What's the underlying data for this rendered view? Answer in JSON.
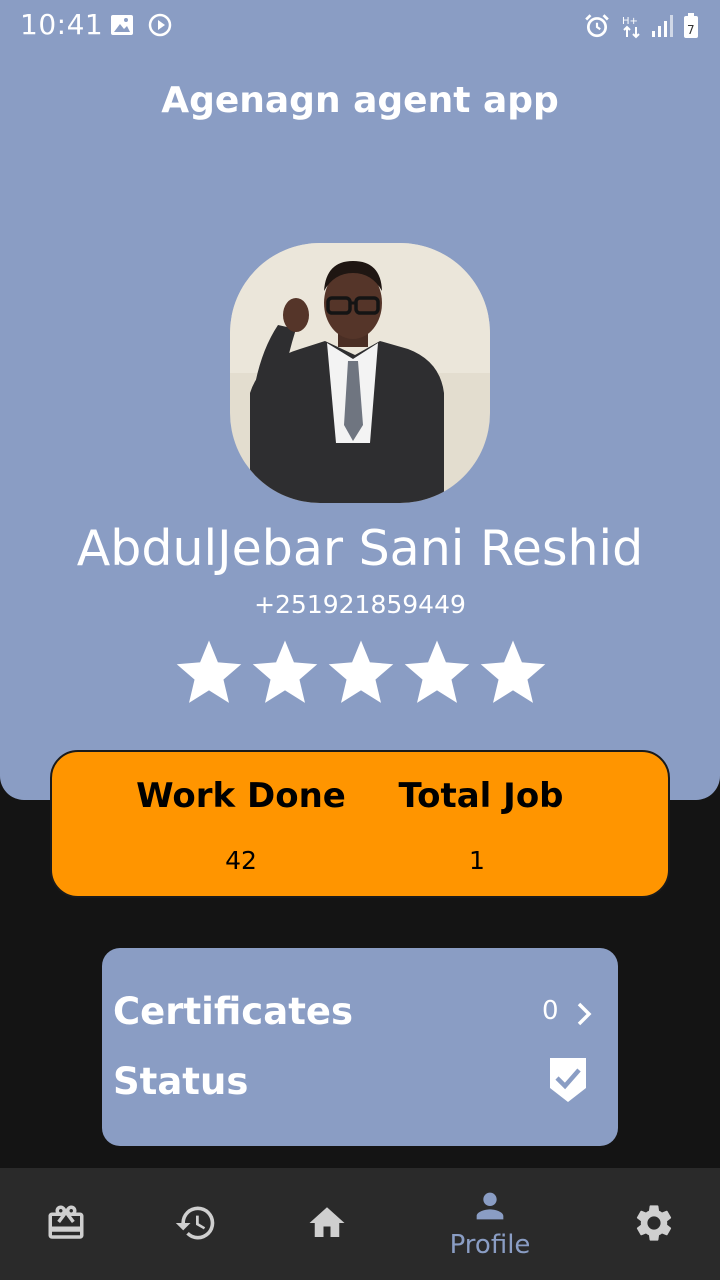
{
  "status_bar": {
    "time": "10:41",
    "icons": [
      "image-icon",
      "play-circle-icon",
      "alarm-icon",
      "data-arrows-icon",
      "signal-icon",
      "battery-icon"
    ]
  },
  "app": {
    "title": "Agenagn agent app"
  },
  "profile": {
    "name": "AbdulJebar Sani Reshid",
    "phone": "+251921859449",
    "rating": 5,
    "rating_max": 5
  },
  "stats": {
    "work_done_label": "Work Done",
    "work_done_value": "42",
    "total_job_label": "Total Job",
    "total_job_value": "1"
  },
  "info": {
    "certificates_label": "Certificates",
    "certificates_count": "0",
    "status_label": "Status",
    "status_checked": true
  },
  "nav": {
    "items": [
      {
        "icon": "gift-card-icon",
        "label": ""
      },
      {
        "icon": "history-icon",
        "label": ""
      },
      {
        "icon": "home-icon",
        "label": ""
      },
      {
        "icon": "person-icon",
        "label": "Profile",
        "active": true
      },
      {
        "icon": "gear-icon",
        "label": ""
      }
    ]
  },
  "colors": {
    "header_bg": "#8a9dc4",
    "stats_bg": "#ff9500",
    "page_bg": "#141414",
    "nav_bg": "#2a2a2a",
    "nav_inactive": "#cfcfcf",
    "nav_active": "#8a9dc4"
  }
}
